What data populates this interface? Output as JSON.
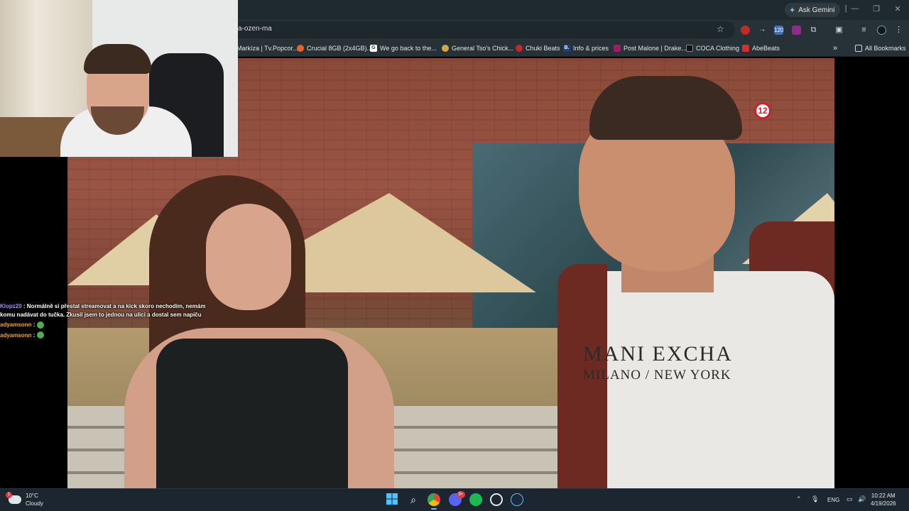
{
  "browser": {
    "ask_gemini_label": "Ask Gemini",
    "url_fragment": "a-ozen-ma",
    "bookmarks": [
      {
        "label": "Markíza | Tv.Popcor...",
        "color": "#c0392b",
        "glyph": ""
      },
      {
        "label": "Crucial 8GB (2x4GB)...",
        "color": "#e8632a",
        "glyph": ""
      },
      {
        "label": "We go back to the...",
        "color": "#ffffff",
        "glyph": "G"
      },
      {
        "label": "General Tso's Chick...",
        "color": "#d8a448",
        "glyph": ""
      },
      {
        "label": "Chuki Beats",
        "color": "#c62828",
        "glyph": ""
      },
      {
        "label": "Info & prices",
        "color": "#1e3a8a",
        "glyph": "B."
      },
      {
        "label": "Post Malone | Drake...",
        "color": "#9c1c6a",
        "glyph": ""
      },
      {
        "label": "COCA Clothing",
        "color": "#111111",
        "glyph": ""
      },
      {
        "label": "AbeBeats",
        "color": "#d32f2f",
        "glyph": ""
      }
    ],
    "more_bookmarks_label": "»",
    "all_bookmarks_label": "All Bookmarks",
    "extension_badge": "120"
  },
  "video": {
    "age_rating": "12",
    "shirt_line1": "MANI EXCHA",
    "shirt_line2": "MILANO / NEW YORK"
  },
  "chat": {
    "messages": [
      {
        "user": "Klopz20",
        "sep": " : ",
        "text": "Normálně si přestal streamovat a na kick skoro nechodím, nemám komu nadávat do tučka. Zkusil jsem to jednou na ulici a dostal sem napiču",
        "emote": false,
        "user_color": "#a98bff"
      },
      {
        "user": "adyamsonn",
        "sep": " : ",
        "text": "",
        "emote": true,
        "user_color": "#f5a623"
      },
      {
        "user": "adyamsonn",
        "sep": " : ",
        "text": "",
        "emote": true,
        "user_color": "#f5a623"
      }
    ]
  },
  "taskbar": {
    "weather_temp": "10°C",
    "weather_desc": "Cloudy",
    "weather_alert": "1",
    "discord_badge": "9+",
    "language": "ENG",
    "time": "10:22 AM",
    "date": "4/19/2026"
  }
}
